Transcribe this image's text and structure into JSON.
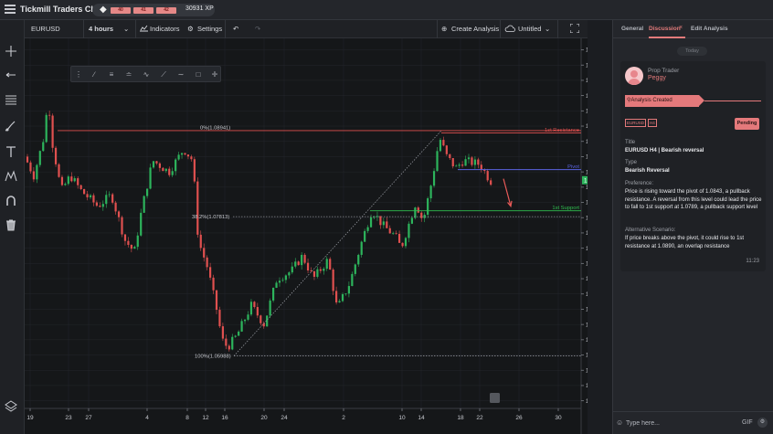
{
  "app": {
    "title": "Tickmill Traders Club"
  },
  "xp": {
    "levels": [
      "40",
      "41",
      "42"
    ],
    "total": "30931 XP",
    "fill_fraction": 0.5
  },
  "toolbar": {
    "symbol": "EURUSD",
    "interval": "4 hours",
    "indicators_label": "Indicators",
    "settings_label": "Settings",
    "create_analysis_label": "Create Analysis",
    "layout_name": "Untitled"
  },
  "drawing_tools": [
    "drag-handle-icon",
    "trend-line-icon",
    "fib-retracement-icon",
    "parallel-channel-icon",
    "path-icon",
    "line-icon",
    "brush-icon",
    "rectangle-icon",
    "crosshair-icon"
  ],
  "left_tools": [
    "crosshair-icon",
    "arrow-line-icon",
    "horizontal-lines-icon",
    "brush-icon",
    "text-icon",
    "pattern-icon",
    "magnet-icon",
    "trash-icon",
    "layers-icon"
  ],
  "chart_data": {
    "type": "candlestick",
    "symbol": "EURUSD",
    "timeframe": "H4",
    "y_ticks": [
      "1.10000",
      "1.09800",
      "1.09600",
      "1.09400",
      "1.09200",
      "1.09000",
      "1.08800",
      "1.08600",
      "1.08400",
      "1.08200",
      "1.08000",
      "1.07800",
      "1.07600",
      "1.07400",
      "1.07200",
      "1.07000",
      "1.06800",
      "1.06600",
      "1.06400",
      "1.06200",
      "1.06000",
      "1.05800",
      "1.05600",
      "1.05400"
    ],
    "ylim": [
      1.053,
      1.1015
    ],
    "x_ticks": [
      "19",
      "23",
      "27",
      "4",
      "8",
      "12",
      "16",
      "20",
      "24",
      "2",
      "10",
      "14",
      "18",
      "22",
      "26",
      "30"
    ],
    "current_price": "1.08291",
    "current_value": 1.08291,
    "levels": [
      {
        "label": "0%(1.08941)",
        "value": 1.08941,
        "color": "#e0504f",
        "style": "solid"
      },
      {
        "label": "38.2%(1.07813)",
        "value": 1.07813,
        "color": "#8a8d93",
        "style": "dotted"
      },
      {
        "label": "100%(1.05988)",
        "value": 1.05988,
        "color": "#8a8d93",
        "style": "dotted"
      },
      {
        "label": "1st Resistance",
        "value": 1.0891,
        "color": "#e0504f",
        "style": "solid"
      },
      {
        "label": "Pivot",
        "value": 1.0843,
        "color": "#5a63e0",
        "style": "solid"
      },
      {
        "label": "1st Support",
        "value": 1.0789,
        "color": "#2fbf4f",
        "style": "solid"
      }
    ],
    "colors": {
      "up": "#2db45c",
      "down": "#e0504f",
      "background": "#151719",
      "grid": "#24272c"
    }
  },
  "panel": {
    "tabs": [
      "General",
      "Discussion",
      "Edit Analysis"
    ],
    "active_tab": "Discussion",
    "today_label": "Today",
    "author_role": "Prop Trader",
    "author_name": "Peggy",
    "status_label": "Analysis Created",
    "tags": [
      "EURUSD",
      "H4"
    ],
    "pending_label": "Pending",
    "title_label": "Title",
    "title": "EURUSD H4 | Bearish reversal",
    "type_label": "Type",
    "type": "Bearish Reversal",
    "preference_label": "Preference:",
    "preference": "Price is rising toward the pivot of 1.0843, a pullback resistance. A reversal from this level could lead the price to fall to 1st support at 1.0789, a pullback support level",
    "alt_label": "Alternative Scenario:",
    "alternative": "If price breaks above the pivot, it could rise to 1st resistance at 1.0890, an overlap resistance",
    "time": "11:23",
    "input_placeholder": "Type here...",
    "gif_label": "GIF"
  }
}
